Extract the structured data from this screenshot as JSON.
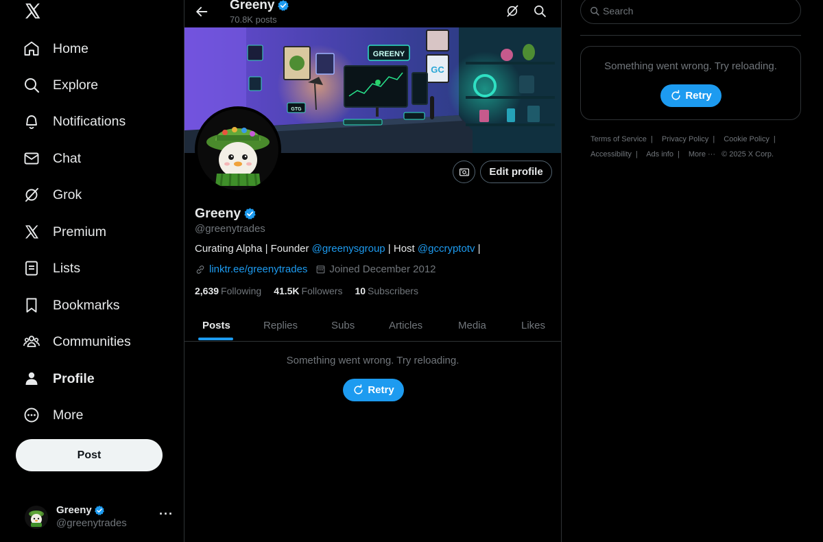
{
  "nav": {
    "items": [
      {
        "label": "Home",
        "icon": "home-icon"
      },
      {
        "label": "Explore",
        "icon": "search-icon"
      },
      {
        "label": "Notifications",
        "icon": "bell-icon"
      },
      {
        "label": "Chat",
        "icon": "envelope-icon"
      },
      {
        "label": "Grok",
        "icon": "grok-icon"
      },
      {
        "label": "Premium",
        "icon": "x-logo-icon"
      },
      {
        "label": "Lists",
        "icon": "list-icon"
      },
      {
        "label": "Bookmarks",
        "icon": "bookmark-icon"
      },
      {
        "label": "Communities",
        "icon": "people-icon"
      },
      {
        "label": "Profile",
        "icon": "person-icon"
      },
      {
        "label": "More",
        "icon": "more-circle-icon"
      }
    ],
    "post_button": "Post"
  },
  "account": {
    "name": "Greeny",
    "handle": "@greenytrades",
    "more": "···"
  },
  "header": {
    "name": "Greeny",
    "post_count": "70.8K posts"
  },
  "banner": {
    "sign_text": "GREENY",
    "logo_text": "GC",
    "small_sign": "GTG"
  },
  "profile": {
    "name": "Greeny",
    "handle": "@greenytrades",
    "bio": {
      "part1": "Curating Alpha | Founder ",
      "mention1": "@greenysgroup",
      "part2": " | Host ",
      "mention2": "@gccryptotv",
      "part3": " |"
    },
    "link": "linktr.ee/greenytrades",
    "joined": "Joined December 2012",
    "edit_button": "Edit profile",
    "stats": {
      "following_count": "2,639",
      "following_label": "Following",
      "followers_count": "41.5K",
      "followers_label": "Followers",
      "subscribers_count": "10",
      "subscribers_label": "Subscribers"
    }
  },
  "tabs": [
    "Posts",
    "Replies",
    "Subs",
    "Articles",
    "Media",
    "Likes"
  ],
  "main_error": {
    "message": "Something went wrong. Try reloading.",
    "retry": "Retry"
  },
  "right": {
    "search_placeholder": "Search",
    "error_message": "Something went wrong. Try reloading.",
    "retry": "Retry",
    "footer": [
      "Terms of Service",
      "Privacy Policy",
      "Cookie Policy",
      "Accessibility",
      "Ads info",
      "More ···",
      "© 2025 X Corp."
    ]
  },
  "colors": {
    "accent": "#1d9bf0",
    "background": "#000000",
    "text_primary": "#e7e9ea",
    "text_secondary": "#71767b",
    "border": "#2f3336",
    "banner_purple": "#5b3fb8",
    "banner_teal": "#1fd6b0"
  }
}
